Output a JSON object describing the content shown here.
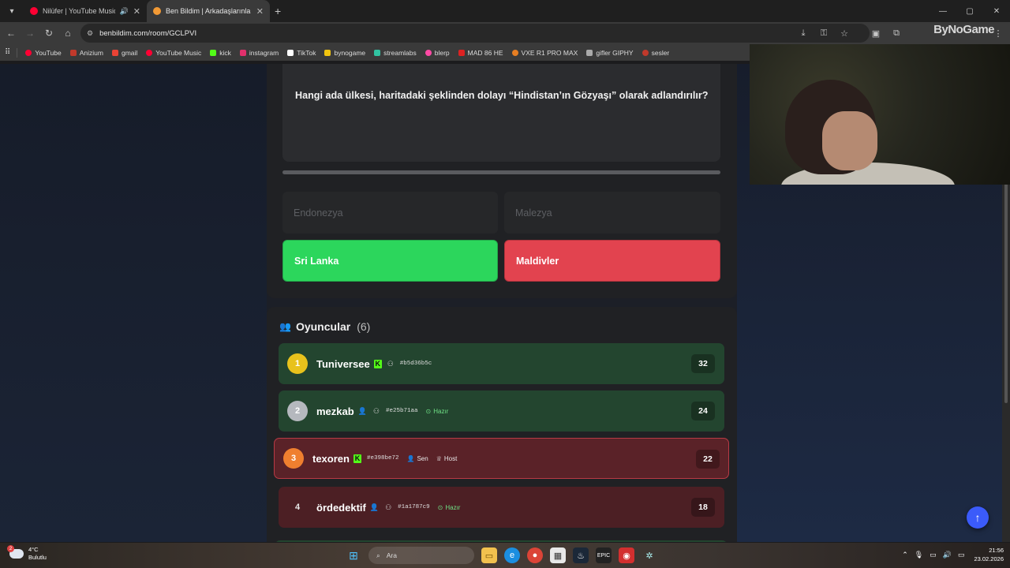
{
  "browser": {
    "tabs": [
      {
        "title": "Nilüfer | YouTube Music",
        "favicon_color": "#ff0033"
      },
      {
        "title": "Ben Bildim | Arkadaşlarınla Onli",
        "favicon_color": "#f29a35"
      }
    ],
    "url": "benbildim.com/room/GCLPVI",
    "profile_label": "ByNoGame"
  },
  "bookmarks": [
    {
      "label": "YouTube",
      "color": "#ff0033"
    },
    {
      "label": "Anizium",
      "color": "#c0392b"
    },
    {
      "label": "gmail",
      "color": "#ea4335"
    },
    {
      "label": "YouTube Music",
      "color": "#ff0033"
    },
    {
      "label": "kick",
      "color": "#53fc18"
    },
    {
      "label": "instagram",
      "color": "#e1306c"
    },
    {
      "label": "TikTok",
      "color": "#ffffff"
    },
    {
      "label": "bynogame",
      "color": "#f1c40f"
    },
    {
      "label": "streamlabs",
      "color": "#31c3a2"
    },
    {
      "label": "blerp",
      "color": "#ff4aa5"
    },
    {
      "label": "MAD 86 HE",
      "color": "#d22"
    },
    {
      "label": "VXE R1 PRO MAX",
      "color": "#e67e22"
    },
    {
      "label": "gifler GIPHY",
      "color": "#aaaaaa"
    },
    {
      "label": "sesler",
      "color": "#c0392b"
    }
  ],
  "quiz": {
    "question": "Hangi ada ülkesi, haritadaki şeklinden dolayı “Hindistan’ın Gözyaşı” olarak adlandırılır?",
    "progress_fraction": 1.0,
    "answers": [
      {
        "label": "Endonezya",
        "state": "dim"
      },
      {
        "label": "Malezya",
        "state": "dim"
      },
      {
        "label": "Sri Lanka",
        "state": "correct"
      },
      {
        "label": "Maldivler",
        "state": "wrong"
      }
    ]
  },
  "players": {
    "title": "Oyuncular",
    "count": "(6)",
    "rows": [
      {
        "rank": "1",
        "name": "Tuniversee",
        "tag": "#b5d36b5c",
        "score": "32",
        "ready": "",
        "sen": "",
        "host": ""
      },
      {
        "rank": "2",
        "name": "mezkab",
        "tag": "#e25b71aa",
        "score": "24",
        "ready": "Hazır",
        "sen": "",
        "host": ""
      },
      {
        "rank": "3",
        "name": "texoren",
        "tag": "#e398be72",
        "score": "22",
        "ready": "",
        "sen": "Sen",
        "host": "Host"
      },
      {
        "rank": "4",
        "name": "ördedektif",
        "tag": "#1a1787c9",
        "score": "18",
        "ready": "Hazır",
        "sen": "",
        "host": ""
      }
    ]
  },
  "taskbar": {
    "weather_temp": "4°C",
    "weather_desc": "Bulutlu",
    "weather_badge": "2",
    "search_placeholder": "Ara",
    "time": "21:56",
    "date": "23.02.2026"
  },
  "colors": {
    "correct": "#2cd65c",
    "wrong": "#e2434f",
    "scroll_button": "#3b5bfa"
  }
}
